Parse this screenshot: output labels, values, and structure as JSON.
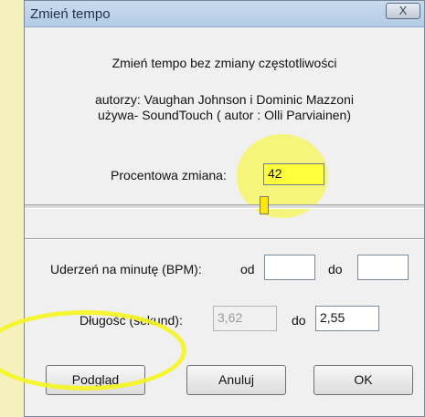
{
  "window": {
    "title": "Zmień tempo",
    "close_label": "X"
  },
  "dialog": {
    "heading": "Zmień tempo bez zmiany częstotliwości",
    "authors": "autorzy: Vaughan Johnson i Dominic Mazzoni",
    "uses": "używa- SoundTouch ( autor : Olli Parviainen)"
  },
  "percent": {
    "label": "Procentowa zmiana:",
    "value": "42"
  },
  "slider": {
    "level": 0.6
  },
  "bpm": {
    "label": "Uderzeń na minutę (BPM):",
    "from_label": "od",
    "from_value": "",
    "to_label": "do",
    "to_value": ""
  },
  "length": {
    "label": "Długość (sekund):",
    "from_value": "3,62",
    "to_label": "do",
    "to_value": "2,55"
  },
  "buttons": {
    "preview": "Podgląd",
    "cancel": "Anuluj",
    "ok": "OK"
  },
  "colors": {
    "highlight": "#ffff3c",
    "background": "#f4f1bf"
  }
}
